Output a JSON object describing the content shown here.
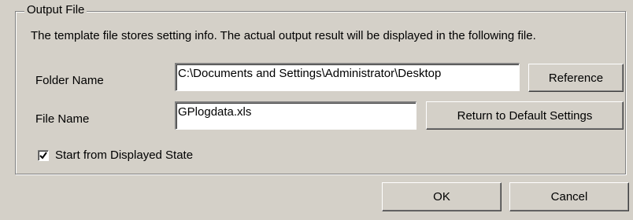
{
  "group": {
    "title": "Output File",
    "description": "The template file stores setting info. The actual output result will be displayed in the following file."
  },
  "folder": {
    "label": "Folder Name",
    "value": "C:\\Documents and Settings\\Administrator\\Desktop",
    "button": "Reference"
  },
  "file": {
    "label": "File Name",
    "value": "GPlogdata.xls",
    "button": "Return to Default Settings"
  },
  "start_option": {
    "label": "Start from Displayed State",
    "checked": true
  },
  "footer": {
    "ok": "OK",
    "cancel": "Cancel"
  },
  "icons": {
    "checkbox": "checkmark-icon"
  }
}
